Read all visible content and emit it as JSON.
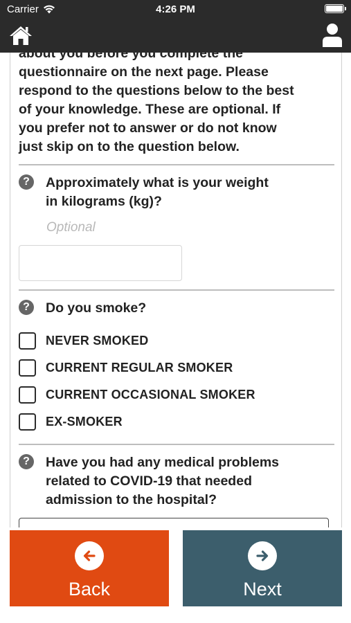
{
  "status_bar": {
    "carrier": "Carrier",
    "time": "4:26 PM"
  },
  "header": {
    "home_icon": "home-icon",
    "profile_icon": "user-profile-icon"
  },
  "intro": {
    "lines": [
      "about you before you complete the",
      "questionnaire on the next page. Please",
      "respond to the questions below to the best",
      "of your knowledge. These are optional. If",
      "you prefer not to answer or do not know",
      "just skip on to the question below."
    ]
  },
  "questions": {
    "weight": {
      "icon": "?",
      "line1": "Approximately what is your weight",
      "line2": "in kilograms (kg)?",
      "optional_label": "Optional",
      "value": ""
    },
    "smoke": {
      "icon": "?",
      "text": "Do you smoke?",
      "options": [
        "NEVER SMOKED",
        "CURRENT REGULAR SMOKER",
        "CURRENT OCCASIONAL SMOKER",
        "EX-SMOKER"
      ]
    },
    "covid": {
      "icon": "?",
      "line1": "Have you had any medical problems",
      "line2": "related to COVID-19 that needed",
      "line3": "admission to the hospital?"
    }
  },
  "buttons": {
    "back_label": "Back",
    "next_label": "Next"
  },
  "colors": {
    "header_bg": "#2b2b2b",
    "back_bg": "#e04a12",
    "next_bg": "#3c5e6c"
  }
}
